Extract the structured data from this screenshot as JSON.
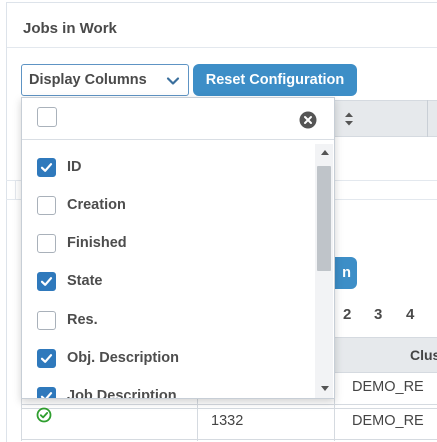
{
  "panel": {
    "title": "Jobs in Work"
  },
  "toolbar": {
    "display_columns_label": "Display Columns",
    "reset_label": "Reset Configuration"
  },
  "background": {
    "button_peek_text": "n",
    "pagination": [
      "2",
      "3",
      "4"
    ],
    "grid_header_label": "Clus",
    "rows": [
      {
        "id": "",
        "cluster": "DEMO_RE",
        "status_icon": ""
      },
      {
        "id": "1332",
        "cluster": "DEMO_RE",
        "status_icon": "check-circle-icon"
      }
    ]
  },
  "dropdown": {
    "filter_value": "",
    "options": [
      {
        "label": "ID",
        "checked": true
      },
      {
        "label": "Creation",
        "checked": false
      },
      {
        "label": "Finished",
        "checked": false
      },
      {
        "label": "State",
        "checked": true
      },
      {
        "label": "Res.",
        "checked": false
      },
      {
        "label": "Obj. Description",
        "checked": true
      },
      {
        "label": "Job Description",
        "checked": true
      }
    ]
  },
  "colors": {
    "accent": "#3d8ec7",
    "checkbox_on": "#2f79bc",
    "ok_green": "#2e9e2e"
  }
}
